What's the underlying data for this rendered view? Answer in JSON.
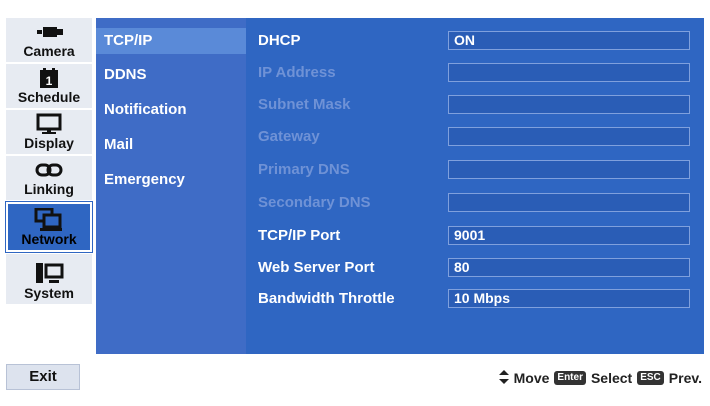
{
  "sidebar": {
    "items": [
      {
        "label": "Camera",
        "icon": "camera-icon"
      },
      {
        "label": "Schedule",
        "icon": "calendar-icon"
      },
      {
        "label": "Display",
        "icon": "monitor-icon"
      },
      {
        "label": "Linking",
        "icon": "link-icon"
      },
      {
        "label": "Network",
        "icon": "network-icon",
        "active": true
      },
      {
        "label": "System",
        "icon": "computer-icon"
      }
    ]
  },
  "submenu": {
    "items": [
      {
        "label": "TCP/IP",
        "active": true
      },
      {
        "label": "DDNS"
      },
      {
        "label": "Notification"
      },
      {
        "label": "Mail"
      },
      {
        "label": "Emergency"
      }
    ]
  },
  "settings": [
    {
      "label": "DHCP",
      "value": "ON",
      "enabled": true
    },
    {
      "label": "IP Address",
      "value": "",
      "enabled": false
    },
    {
      "label": "Subnet Mask",
      "value": "",
      "enabled": false
    },
    {
      "label": "Gateway",
      "value": "",
      "enabled": false
    },
    {
      "label": "Primary DNS",
      "value": "",
      "enabled": false
    },
    {
      "label": "Secondary DNS",
      "value": "",
      "enabled": false
    },
    {
      "label": "TCP/IP Port",
      "value": "9001",
      "enabled": true
    },
    {
      "label": "Web Server Port",
      "value": "80",
      "enabled": true
    },
    {
      "label": "Bandwidth Throttle",
      "value": "10 Mbps",
      "enabled": true
    }
  ],
  "footer": {
    "exit_label": "Exit",
    "move_label": "Move",
    "enter_key": "Enter",
    "select_label": "Select",
    "esc_key": "ESC",
    "prev_label": "Prev."
  },
  "colors": {
    "panel_blue": "#2f66c2",
    "submenu_blue": "#3f6cc6",
    "disabled_text": "#6f92d6"
  }
}
